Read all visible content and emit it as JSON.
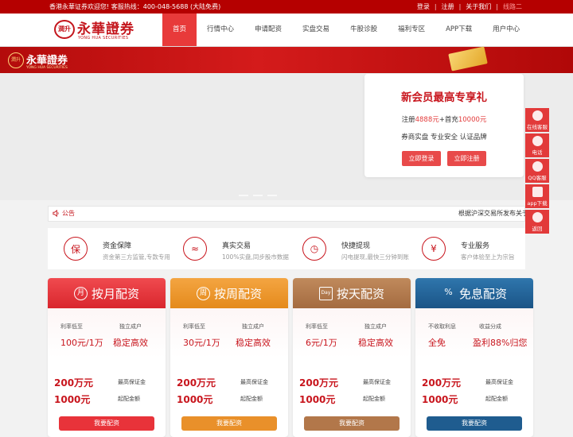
{
  "topbar": {
    "welcome": "香港永華证券欢迎您! 客服热线：400-048-5688 (大陆免费)",
    "login": "登录",
    "register": "注册",
    "about": "关于我们",
    "line2": "线路二"
  },
  "logo": {
    "seal": "潤升",
    "cn": "永華證券",
    "en": "YONG HUA SECURITIES"
  },
  "menu": [
    "首页",
    "行情中心",
    "申请配资",
    "实盘交易",
    "牛股诊股",
    "福利专区",
    "APP下载",
    "用户中心"
  ],
  "promo": {
    "title": "新会员最高专享礼",
    "reg_a": "注册",
    "reg_b": "4888元",
    "reg_c": "+首充",
    "reg_d": "10000元",
    "tags": "券商实盘 专业安全 认证品牌",
    "login_btn": "立即登录",
    "register_btn": "立即注册"
  },
  "notice": {
    "label": "公告",
    "text": "根据沪深交易所发布关于"
  },
  "features": [
    {
      "icon": "保",
      "title": "资金保障",
      "desc": "资金第三方监管,专款专用"
    },
    {
      "icon": "≈",
      "title": "真实交易",
      "desc": "100%实盘,同步股市数据"
    },
    {
      "icon": "◷",
      "title": "快捷提现",
      "desc": "闪电提现,最快三分钟到账"
    },
    {
      "icon": "¥",
      "title": "专业服务",
      "desc": "客户体验至上为宗旨"
    }
  ],
  "cards": [
    {
      "icon": "月",
      "title": "按月配资",
      "l1": "利率低至",
      "l2": "独立成户",
      "v1": "100元/1万",
      "v2": "稳定高效",
      "b1": "200万元",
      "s1": "最高保证金",
      "b2": "1000元",
      "s2": "起配金额",
      "btn": "我要配资",
      "color": "#e8333a",
      "btncolor": "#e8333a"
    },
    {
      "icon": "周",
      "title": "按周配资",
      "l1": "利率低至",
      "l2": "独立成户",
      "v1": "30元/1万",
      "v2": "稳定高效",
      "b1": "200万元",
      "s1": "最高保证金",
      "b2": "1000元",
      "s2": "起配金额",
      "btn": "我要配资",
      "color": "#e9902a",
      "btncolor": "#e9902a"
    },
    {
      "icon": "Day",
      "title": "按天配资",
      "l1": "利率低至",
      "l2": "独立成户",
      "v1": "6元/1万",
      "v2": "稳定高效",
      "b1": "200万元",
      "s1": "最高保证金",
      "b2": "1000元",
      "s2": "起配金额",
      "btn": "我要配资",
      "color": "#b2774a",
      "btncolor": "#b2774a"
    },
    {
      "icon": "%",
      "title": "免息配资",
      "l1": "不收取利息",
      "l2": "收益分成",
      "v1": "全免",
      "v2": "盈利88%归您",
      "b1": "200万元",
      "s1": "最高保证金",
      "b2": "1000元",
      "s2": "起配金额",
      "btn": "我要配资",
      "color": "#1f5c8f",
      "btncolor": "#1f5c8f"
    }
  ],
  "side": [
    "在线客服",
    "电话",
    "QQ客服",
    "app下载",
    "返回"
  ]
}
